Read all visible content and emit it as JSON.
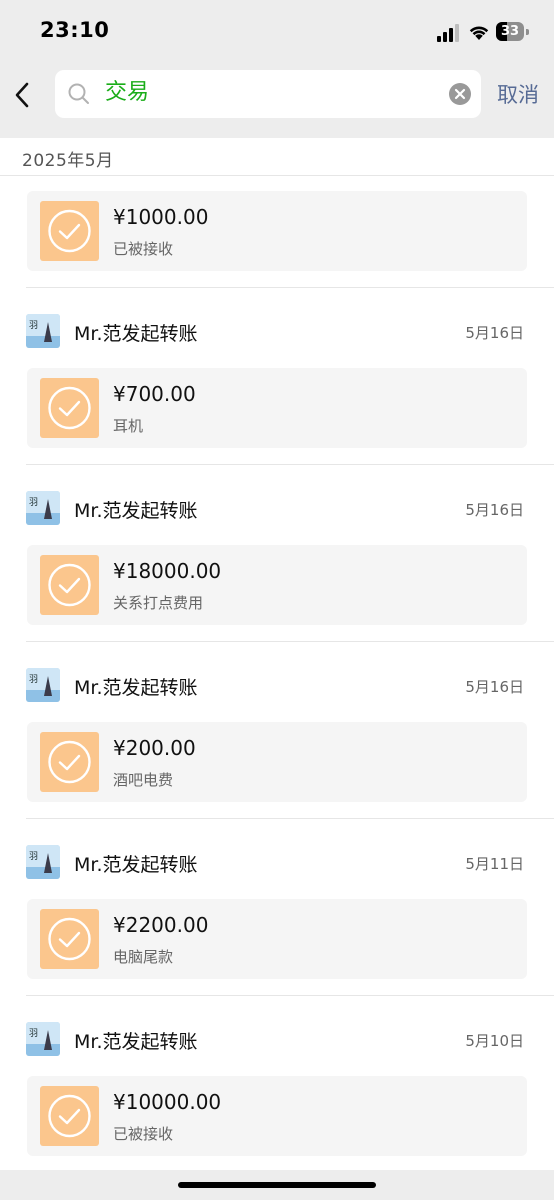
{
  "status_bar": {
    "time": "23:10",
    "battery": "33"
  },
  "search": {
    "query": "交易",
    "cancel_label": "取消"
  },
  "month_label": "2025年5月",
  "records": [
    {
      "sender": "",
      "date": "",
      "amount": "¥1000.00",
      "note": "已被接收"
    },
    {
      "sender": "Mr.范发起转账",
      "date": "5月16日",
      "amount": "¥700.00",
      "note": "耳机"
    },
    {
      "sender": "Mr.范发起转账",
      "date": "5月16日",
      "amount": "¥18000.00",
      "note": "关系打点费用"
    },
    {
      "sender": "Mr.范发起转账",
      "date": "5月16日",
      "amount": "¥200.00",
      "note": "酒吧电费"
    },
    {
      "sender": "Mr.范发起转账",
      "date": "5月11日",
      "amount": "¥2200.00",
      "note": "电脑尾款"
    },
    {
      "sender": "Mr.范发起转账",
      "date": "5月10日",
      "amount": "¥10000.00",
      "note": "已被接收"
    }
  ],
  "icons": {
    "back": "chevron-left-icon",
    "search": "search-icon",
    "clear": "clear-icon",
    "transfer": "check-circle-icon"
  },
  "colors": {
    "header_bg": "#ededed",
    "search_text": "#1aad19",
    "cancel": "#576b95",
    "transfer_icon_bg": "#fbc68d"
  }
}
